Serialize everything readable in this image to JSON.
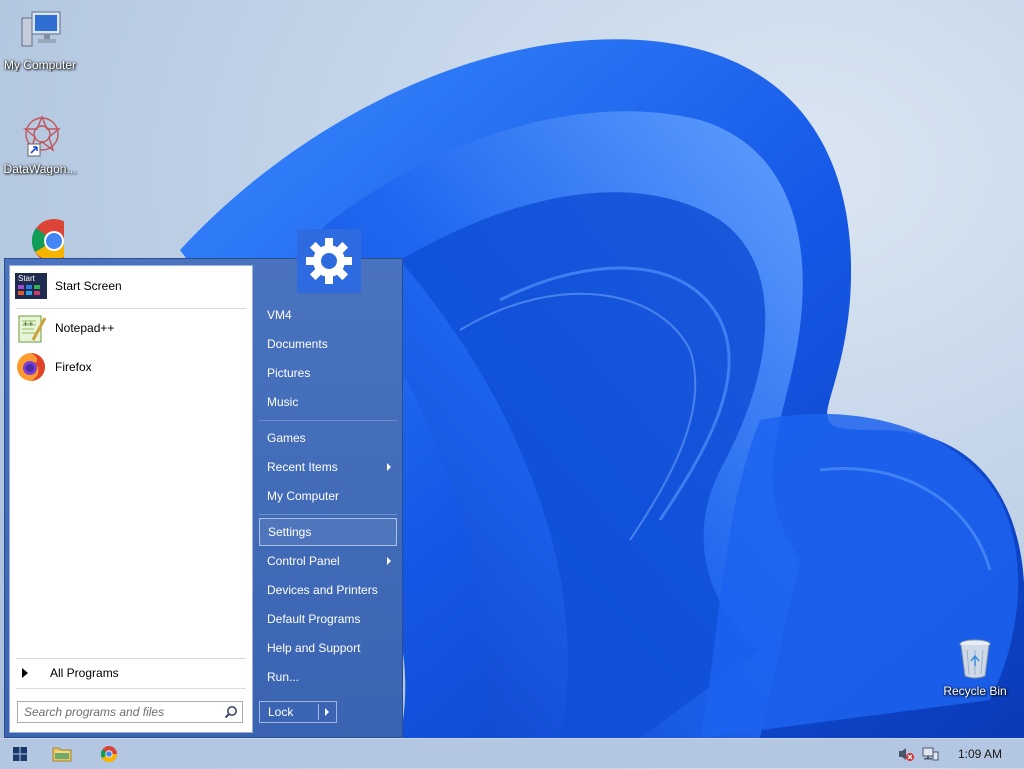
{
  "desktop": {
    "icons": [
      {
        "label": "My Computer",
        "icon": "computer-icon"
      },
      {
        "label": "DataWagon...",
        "icon": "datawagon-icon"
      },
      {
        "label": "",
        "icon": "chrome-icon"
      },
      {
        "label": "Recycle Bin",
        "icon": "recycle-bin-icon"
      }
    ]
  },
  "start_menu": {
    "pinned": [
      {
        "label": "Start Screen",
        "icon": "start-screen-icon"
      },
      {
        "label": "Notepad++",
        "icon": "notepad-plus-plus-icon"
      },
      {
        "label": "Firefox",
        "icon": "firefox-icon"
      }
    ],
    "all_programs": "All Programs",
    "search_placeholder": "Search programs and files",
    "user_tile_icon": "gear-icon",
    "right_items": [
      {
        "label": "VM4"
      },
      {
        "label": "Documents"
      },
      {
        "label": "Pictures"
      },
      {
        "label": "Music"
      },
      {
        "label": "Games"
      },
      {
        "label": "Recent Items",
        "submenu": true
      },
      {
        "label": "My Computer"
      },
      {
        "label": "Settings",
        "highlighted": true
      },
      {
        "label": "Control Panel",
        "submenu": true
      },
      {
        "label": "Devices and Printers"
      },
      {
        "label": "Default Programs"
      },
      {
        "label": "Help and Support"
      },
      {
        "label": "Run..."
      }
    ],
    "lock_label": "Lock"
  },
  "taskbar": {
    "start_icon": "windows-logo-icon",
    "apps": [
      "file-explorer-icon",
      "chrome-icon"
    ],
    "tray": [
      "speaker-muted-icon",
      "network-icon"
    ],
    "clock": "1:09 AM"
  },
  "colors": {
    "menu_blue": "#3f6ab8",
    "taskbar": "#b3c7e3",
    "wallpaper_bloom": "#1a5fe0"
  }
}
